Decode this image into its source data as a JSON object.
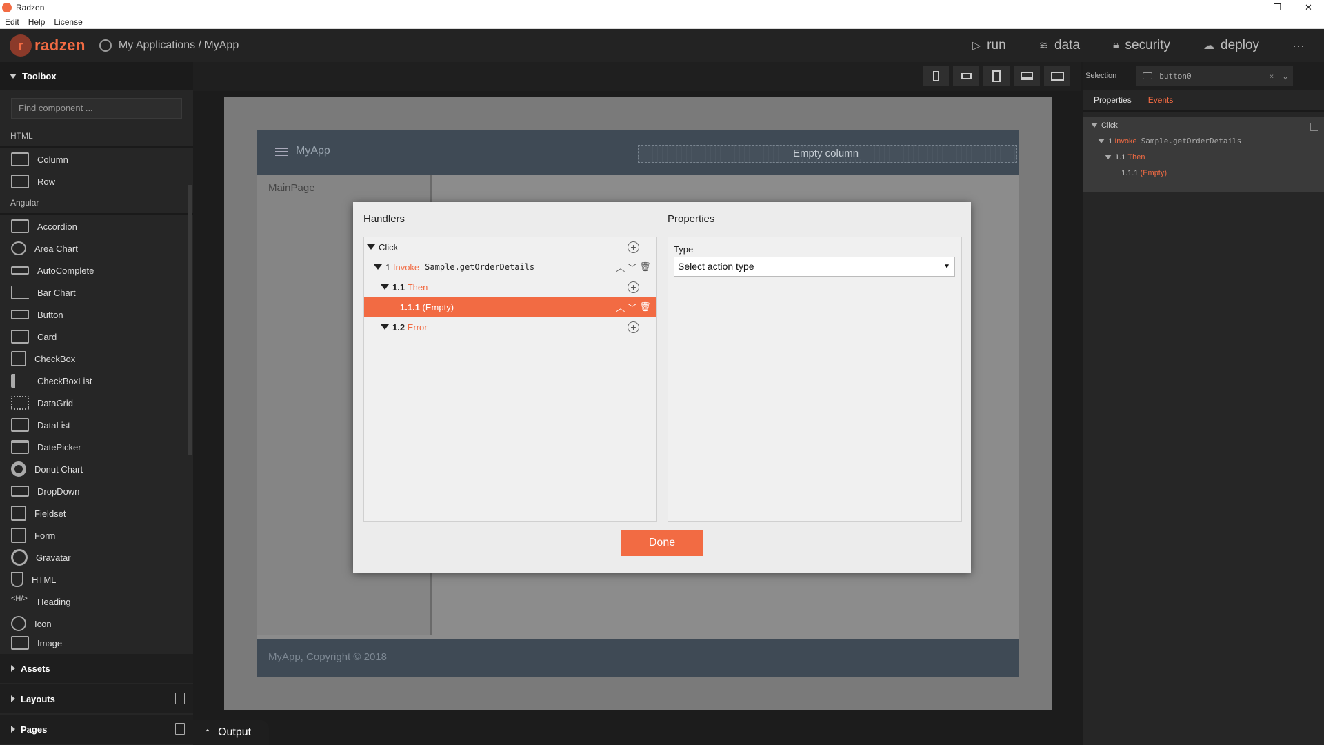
{
  "window": {
    "title": "Radzen",
    "controls": {
      "minimize": "–",
      "restore": "❐",
      "close": "✕"
    }
  },
  "menu": [
    "Edit",
    "Help",
    "License"
  ],
  "nav": {
    "logo_text": "radzen",
    "breadcrumb": "My Applications / MyApp",
    "actions": [
      {
        "label": "run",
        "icon": "play-icon"
      },
      {
        "label": "data",
        "icon": "layers-icon"
      },
      {
        "label": "security",
        "icon": "lock-icon"
      },
      {
        "label": "deploy",
        "icon": "cloud-upload-icon"
      }
    ],
    "more": "···"
  },
  "toolbox": {
    "title": "Toolbox",
    "search_placeholder": "Find component ...",
    "categories": [
      {
        "name": "HTML",
        "items": [
          "Column",
          "Row"
        ]
      },
      {
        "name": "Angular",
        "items": [
          "Accordion",
          "Area Chart",
          "AutoComplete",
          "Bar Chart",
          "Button",
          "Card",
          "CheckBox",
          "CheckBoxList",
          "DataGrid",
          "DataList",
          "DatePicker",
          "Donut Chart",
          "DropDown",
          "Fieldset",
          "Form",
          "Gravatar",
          "HTML",
          "Heading",
          "Icon",
          "Image"
        ]
      }
    ],
    "sections": [
      "Assets",
      "Layouts",
      "Pages"
    ]
  },
  "canvas": {
    "app_title": "MyApp",
    "empty_column": "Empty column",
    "sidebar_item": "MainPage",
    "footer": "MyApp, Copyright © 2018"
  },
  "output": {
    "label": "Output"
  },
  "right_panel": {
    "selection_label": "Selection",
    "selection_value": "button0",
    "tabs": [
      "Properties",
      "Events"
    ],
    "tree": {
      "root": "Click",
      "n1_num": "1",
      "n1_action": "Invoke",
      "n1_method": "Sample.getOrderDetails",
      "n11_num": "1.1",
      "n11_label": "Then",
      "n111_num": "1.1.1",
      "n111_label": "(Empty)"
    }
  },
  "dialog": {
    "handlers_title": "Handlers",
    "properties_title": "Properties",
    "rows": {
      "click": "Click",
      "invoke_num": "1",
      "invoke_label": "Invoke",
      "invoke_method": "Sample.getOrderDetails",
      "then_num": "1.1",
      "then_label": "Then",
      "empty_num": "1.1.1",
      "empty_label": "(Empty)",
      "error_num": "1.2",
      "error_label": "Error"
    },
    "type_label": "Type",
    "type_select": "Select action type",
    "done_label": "Done"
  },
  "colors": {
    "accent": "#f26b43",
    "header": "#3f4a55"
  }
}
